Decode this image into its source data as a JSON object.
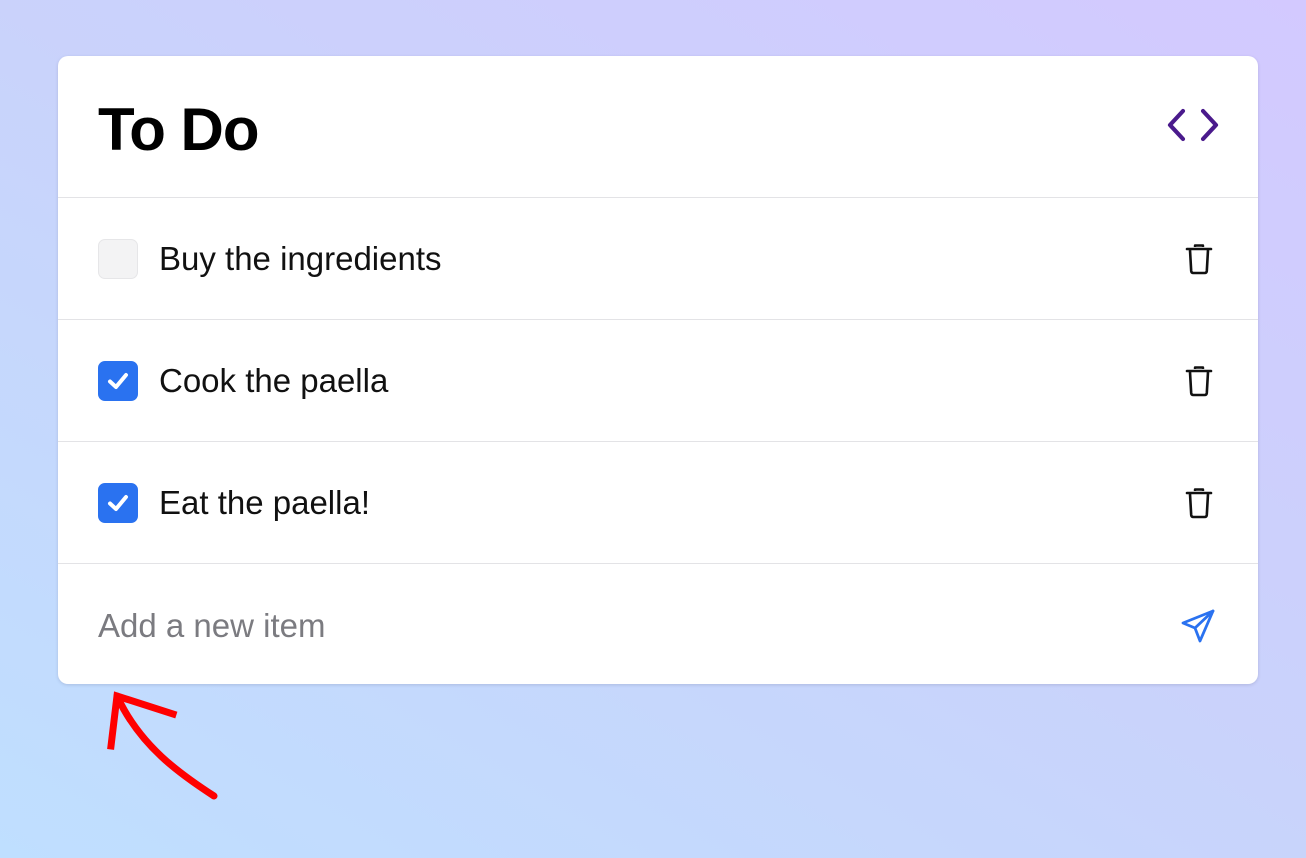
{
  "app": {
    "title": "To Do"
  },
  "header": {
    "code_icon": "code-brackets-icon"
  },
  "todos": [
    {
      "label": "Buy the ingredients",
      "checked": false
    },
    {
      "label": "Cook the paella",
      "checked": true
    },
    {
      "label": "Eat the paella!",
      "checked": true
    }
  ],
  "add_item": {
    "value": "",
    "placeholder": "Add a new item",
    "send_icon": "send-icon"
  },
  "icons": {
    "delete": "trash-icon",
    "check": "check-icon",
    "annotation": "red-arrow-icon"
  },
  "colors": {
    "accent_blue": "#2a72f0",
    "code_icon_purple": "#4a1a8c",
    "annotation_red": "#ff0000"
  }
}
